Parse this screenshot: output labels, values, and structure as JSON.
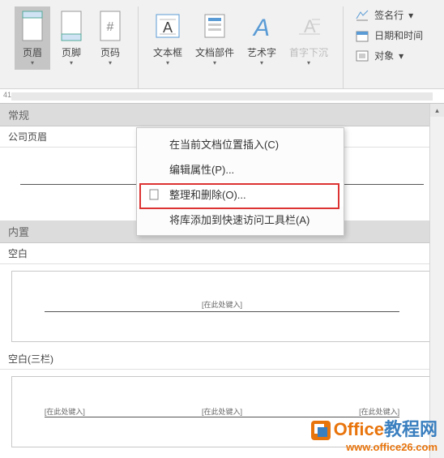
{
  "ribbon": {
    "header_btn": "页眉",
    "footer_btn": "页脚",
    "pagenum_btn": "页码",
    "textbox_btn": "文本框",
    "parts_btn": "文档部件",
    "wordart_btn": "艺术字",
    "dropcap_btn": "首字下沉",
    "signature": "签名行",
    "datetime": "日期和时间",
    "object": "对象"
  },
  "ruler": {
    "mark": "41"
  },
  "gallery": {
    "general": "常规",
    "company_header": "公司页眉",
    "builtin": "内置",
    "blank": "空白",
    "blank_placeholder": "[在此处键入]",
    "blank3": "空白(三栏)",
    "blank3_p1": "[在此处键入]",
    "blank3_p2": "[在此处键入]",
    "blank3_p3": "[在此处键入]"
  },
  "menu": {
    "insert_current": "在当前文档位置插入(C)",
    "edit_props": "编辑属性(P)...",
    "organize": "整理和删除(O)...",
    "add_qat": "将库添加到快速访问工具栏(A)"
  },
  "watermark": {
    "line1a": "Office",
    "line1b": "教程网",
    "line2": "www.office26.com"
  }
}
